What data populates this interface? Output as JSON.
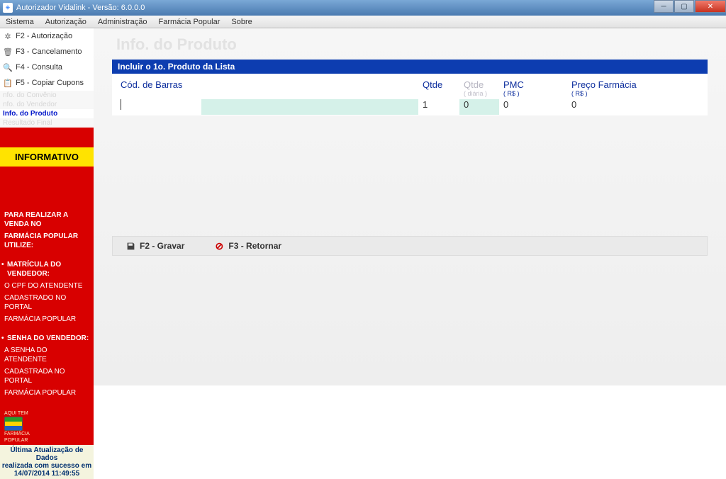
{
  "titlebar": {
    "text": "Autorizador Vidalink - Versão: 6.0.0.0"
  },
  "menubar": [
    "Sistema",
    "Autorização",
    "Administração",
    "Farmácia Popular",
    "Sobre"
  ],
  "sidebar": {
    "f2": "F2 - Autorização",
    "f3": "F3 - Cancelamento",
    "f4": "F4 - Consulta",
    "f5": "F5 - Copiar Cupons",
    "sub1": "nfo. do Convênio",
    "sub2": "nfo. do Vendedor",
    "sub3": "Info. do Produto",
    "sub4": "Resultado Final"
  },
  "info_band": "INFORMATIVO",
  "red": {
    "head1a": "PARA REALIZAR A VENDA NO",
    "head1b": "FARMÁCIA POPULAR UTILIZE:",
    "b1a": "MATRÍCULA DO VENDEDOR:",
    "b1b": "O CPF DO ATENDENTE",
    "b1c": "CADASTRADO NO PORTAL",
    "b1d": "FARMÁCIA POPULAR",
    "b2a": "SENHA DO VENDEDOR:",
    "b2b": "A SENHA DO ATENDENTE",
    "b2c": "CADASTRADA NO PORTAL",
    "b2d": "FARMÁCIA POPULAR",
    "logotxt1": "AQUI TEM",
    "logotxt2": "FARMÁCIA",
    "logotxt3": "POPULAR"
  },
  "footer": {
    "l1": "Última Atualização de Dados",
    "l2": "realizada com sucesso em",
    "l3": "14/07/2014 11:49:55"
  },
  "content": {
    "ghost": "Info. do Produto",
    "panel_header": "Incluir o 1o. Produto da Lista",
    "cols": {
      "barras": "Cód. de Barras",
      "qtde": "Qtde",
      "qtded": "Qtde",
      "qtded_sub": "( diária )",
      "pmc": "PMC",
      "pmc_sub": "( R$ )",
      "preco": "Preço Farmácia",
      "preco_sub": "( R$ )"
    },
    "values": {
      "barras": "",
      "prodname": "",
      "qtde": "1",
      "qtded": "0",
      "pmc": "0",
      "preco": "0"
    },
    "actions": {
      "save": "F2 - Gravar",
      "ret": "F3 - Retornar"
    }
  }
}
